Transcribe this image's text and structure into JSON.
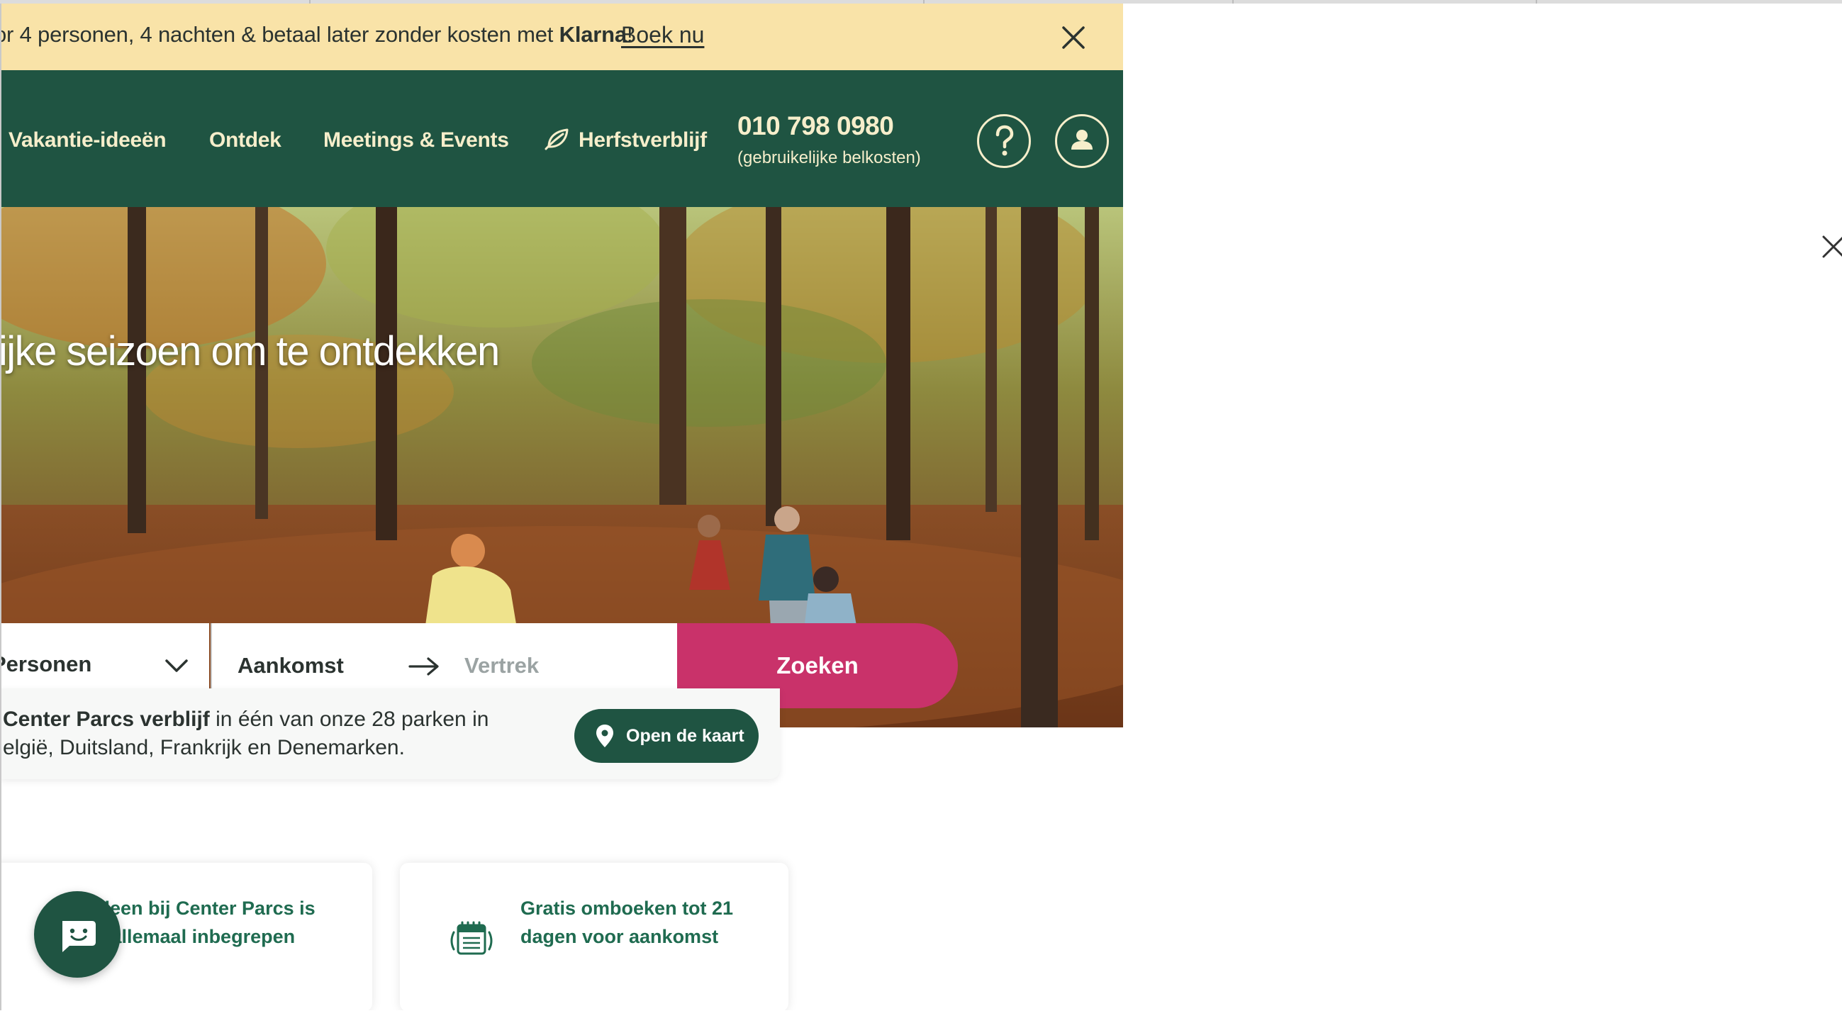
{
  "banner": {
    "text_prefix": "or 4 personen, 4 nachten & betaal later zonder kosten met ",
    "brand": "Klarna",
    "text_suffix": "!",
    "cta": "Boek nu",
    "close_icon": "close-icon"
  },
  "nav": {
    "items": [
      "Vakantie-ideeën",
      "Ontdek",
      "Meetings & Events",
      "Herfstverblijf"
    ],
    "highlight_icon": "leaf-icon",
    "phone": "010 798 0980",
    "phone_note": "(gebruikelijke belkosten)",
    "help_icon": "question-icon",
    "account_icon": "user-icon"
  },
  "hero": {
    "title": "rijke seizoen om te ontdekken"
  },
  "search": {
    "persons": "Personen",
    "arrival": "Aankomst",
    "departure": "Vertrek",
    "submit": "Zoeken"
  },
  "info": {
    "bold": "Center Parcs verblijf",
    "line1_rest": " in één van onze 28 parken in",
    "line2": "elgië, Duitsland, Frankrijk en Denemarken.",
    "map_button": "Open de kaart",
    "map_icon": "map-pin-icon"
  },
  "usps": [
    {
      "line1": "lleen bij Center Parcs is",
      "line2": "t allemaal inbegrepen"
    },
    {
      "line1": "Gratis omboeken tot 21",
      "line2": "dagen voor aankomst",
      "icon": "calendar-icon"
    }
  ],
  "chat": {
    "icon": "chat-icon"
  },
  "colors": {
    "banner_bg": "#f9e3a8",
    "nav_bg": "#1f5442",
    "nav_text": "#f6eecb",
    "search_button": "#c9326a",
    "usp_text": "#1f6b50"
  }
}
